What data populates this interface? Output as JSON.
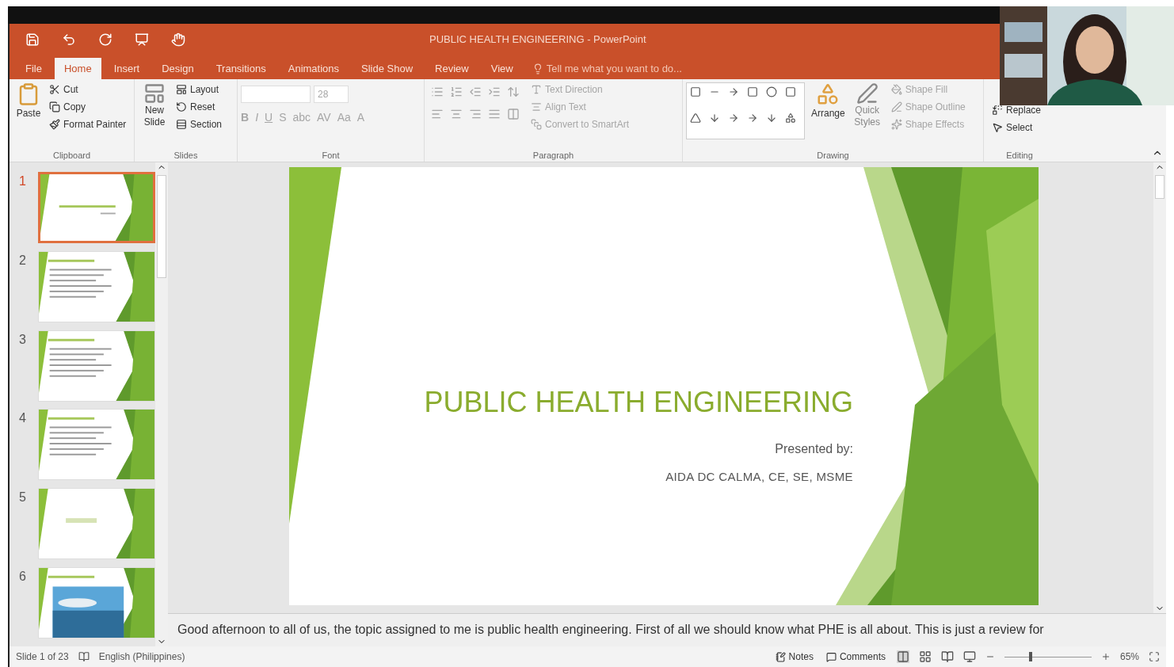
{
  "window": {
    "title": "PUBLIC HEALTH ENGINEERING - PowerPoint"
  },
  "tabs": [
    {
      "label": "File",
      "selected": false
    },
    {
      "label": "Home",
      "selected": true
    },
    {
      "label": "Insert",
      "selected": false
    },
    {
      "label": "Design",
      "selected": false
    },
    {
      "label": "Transitions",
      "selected": false
    },
    {
      "label": "Animations",
      "selected": false
    },
    {
      "label": "Slide Show",
      "selected": false
    },
    {
      "label": "Review",
      "selected": false
    },
    {
      "label": "View",
      "selected": false
    }
  ],
  "tell_me": {
    "placeholder": "Tell me what you want to do..."
  },
  "clipboard": {
    "paste": "Paste",
    "cut": "Cut",
    "copy": "Copy",
    "format_painter": "Format Painter",
    "label": "Clipboard"
  },
  "slides_group": {
    "new_slide": "New Slide",
    "layout": "Layout",
    "reset": "Reset",
    "section": "Section",
    "label": "Slides"
  },
  "font": {
    "size": "28",
    "disabled": true,
    "glyphs": [
      "B",
      "I",
      "U",
      "S",
      "abc",
      "AV",
      "Aa",
      "A"
    ],
    "label": "Font"
  },
  "paragraph": {
    "disabled": true,
    "text_direction": "Text Direction",
    "align_text": "Align Text",
    "convert": "Convert to SmartArt",
    "label": "Paragraph"
  },
  "drawing": {
    "arrange": "Arrange",
    "quick_styles": "Quick Styles",
    "shape_fill": "Shape Fill",
    "shape_outline": "Shape Outline",
    "shape_effects": "Shape Effects",
    "effects_disabled": true,
    "label": "Drawing"
  },
  "editing": {
    "replace": "Replace",
    "select": "Select",
    "label": "Editing"
  },
  "thumbnails": [
    {
      "number": "1",
      "selected": true,
      "kind": "title"
    },
    {
      "number": "2",
      "selected": false,
      "kind": "bullets"
    },
    {
      "number": "3",
      "selected": false,
      "kind": "bullets"
    },
    {
      "number": "4",
      "selected": false,
      "kind": "bullets"
    },
    {
      "number": "5",
      "selected": false,
      "kind": "section"
    },
    {
      "number": "6",
      "selected": false
    }
  ],
  "slide": {
    "title": "PUBLIC HEALTH ENGINEERING",
    "subtitle": "Presented by:",
    "author": "AIDA DC CALMA, CE, SE, MSME"
  },
  "notes": "Good afternoon to all of us, the topic assigned to me is public health engineering. First of all we should know what  PHE is all about. This is just a review for",
  "status_bar": {
    "slide": "Slide 1 of 23",
    "language": "English (Philippines)",
    "notes": "Notes",
    "comments": "Comments",
    "zoom": "65%",
    "zoom_level": {
      "level": 0.3
    }
  }
}
